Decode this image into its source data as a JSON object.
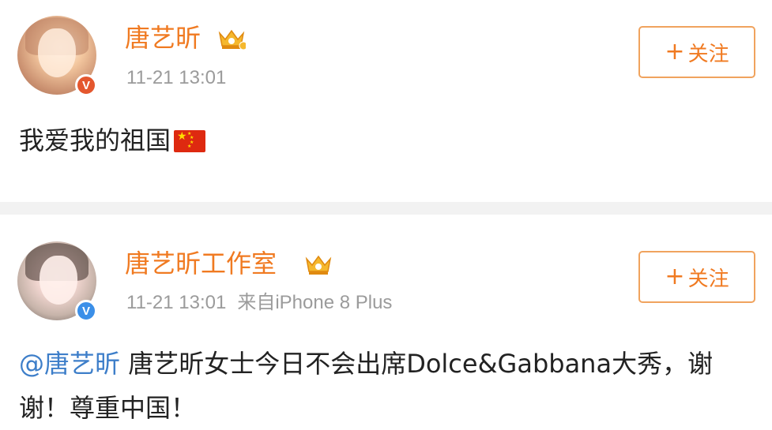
{
  "posts": [
    {
      "author": "唐艺昕",
      "time": "11-21 13:01",
      "source": "",
      "follow_label": "关注",
      "content": "我爱我的祖国",
      "verified_color": "#e4572e"
    },
    {
      "author": "唐艺昕工作室",
      "time": "11-21 13:01",
      "source": "来自iPhone 8 Plus",
      "follow_label": "关注",
      "mention": "@唐艺昕",
      "content": "唐艺昕女士今日不会出席Dolce&Gabbana大秀，谢谢！尊重中国！",
      "verified_color": "#3b8fe8"
    }
  ],
  "icons": {
    "follow_plus": "plus-icon",
    "crown": "crown-icon",
    "verified": "verified-icon",
    "flag": "china-flag-icon"
  },
  "colors": {
    "accent": "#f07a21",
    "mention": "#3d7ec9",
    "meta": "#9b9b9b"
  }
}
